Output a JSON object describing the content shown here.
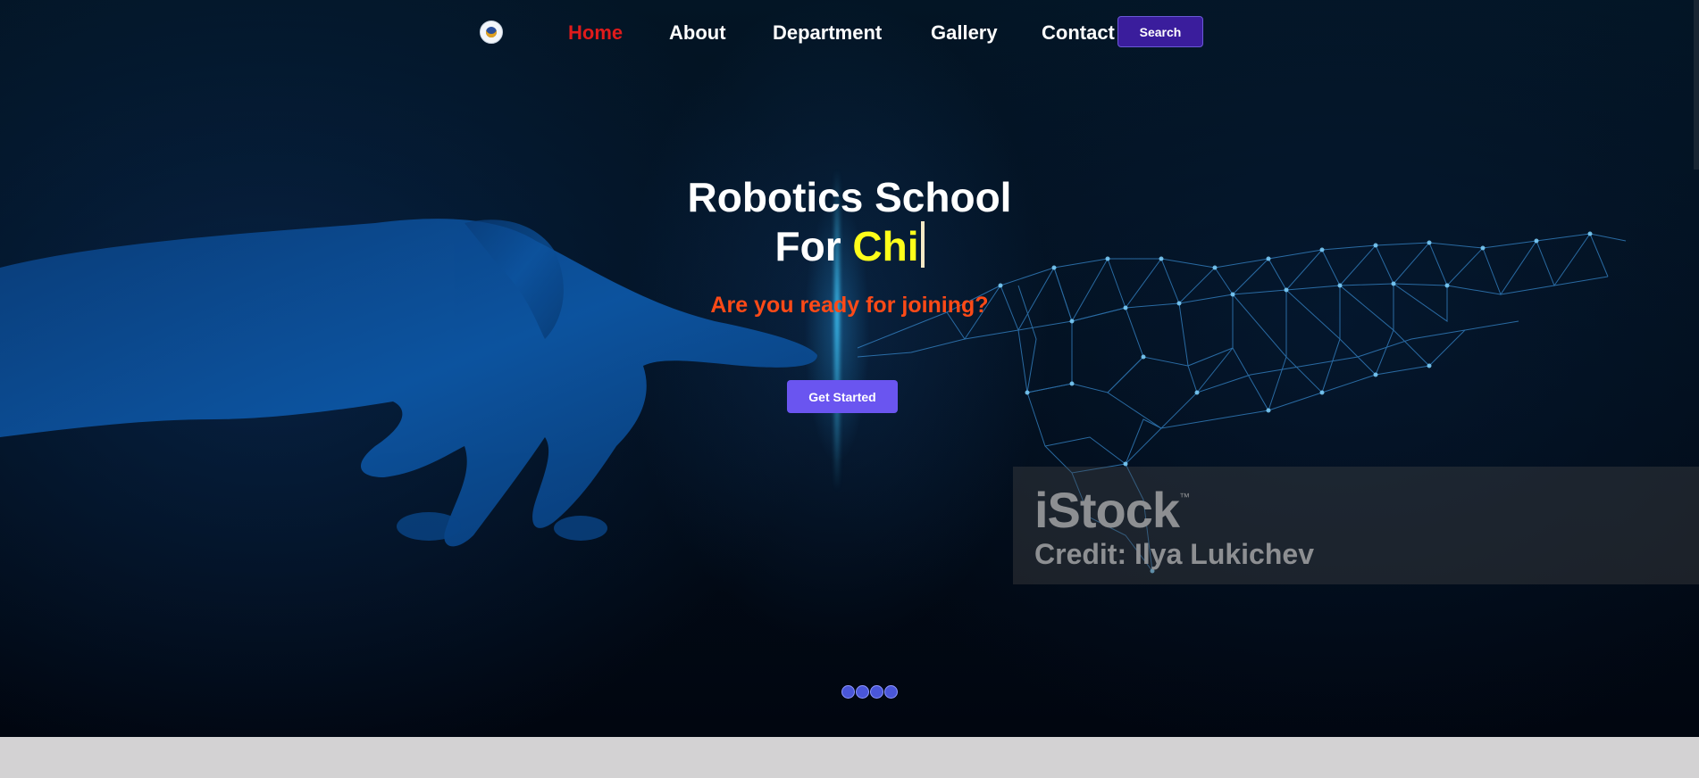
{
  "nav": {
    "logo_icon": "school-logo-icon",
    "links": [
      "Home",
      "About",
      "Department",
      "Gallery",
      "Contact"
    ],
    "active": "Home",
    "search_label": "Search"
  },
  "hero": {
    "title_line1": "Robotics School",
    "title_line2_prefix": "For ",
    "title_line2_typed": "Chi",
    "subtitle": "Are you ready for joining?",
    "cta_label": "Get Started",
    "slide_count": 4
  },
  "watermark": {
    "brand": "iStock",
    "tm": "™",
    "credit": "Credit: Ilya Lukichev"
  },
  "colors": {
    "active_link": "#e01b1b",
    "typed_text": "#ffff1a",
    "subtitle": "#ff4a17",
    "cta_bg": "#6a55f0",
    "search_bg": "#3a1d9c"
  }
}
